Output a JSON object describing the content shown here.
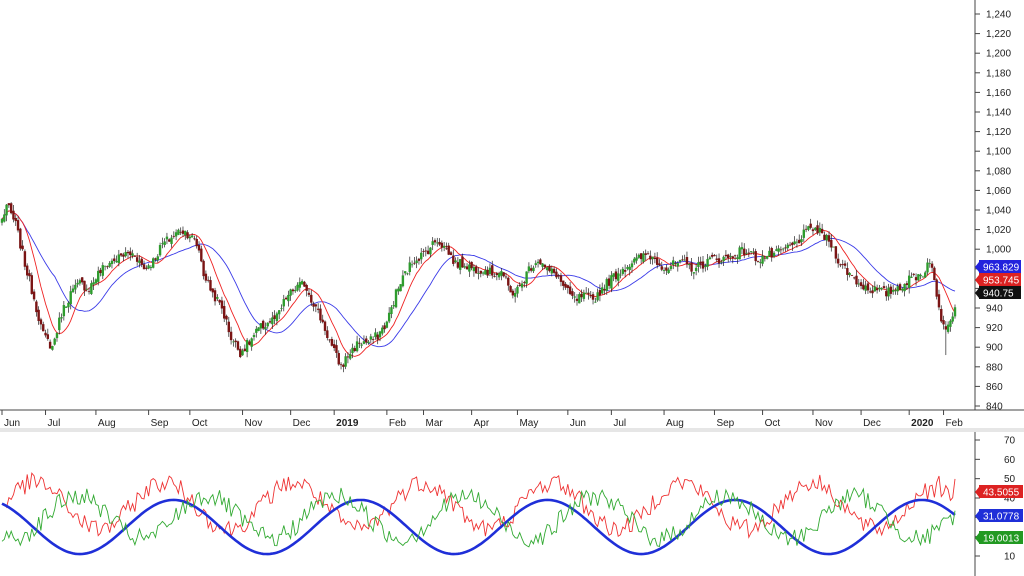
{
  "chart_data": [
    {
      "type": "candlestick",
      "panel": "price",
      "ylim": [
        820,
        1250
      ],
      "y_ticks": [
        "840",
        "860",
        "880",
        "900",
        "920",
        "940",
        "960",
        "980",
        "1,000",
        "1,020",
        "1,040",
        "1,060",
        "1,080",
        "1,100",
        "1,120",
        "1,140",
        "1,160",
        "1,180",
        "1,200",
        "1,220",
        "1,240"
      ],
      "x_labels": [
        {
          "label": "Jun",
          "i": 0
        },
        {
          "label": "Jul",
          "i": 19
        },
        {
          "label": "Aug",
          "i": 41
        },
        {
          "label": "Sep",
          "i": 64
        },
        {
          "label": "Oct",
          "i": 82
        },
        {
          "label": "Nov",
          "i": 105
        },
        {
          "label": "Dec",
          "i": 126
        },
        {
          "label": "2019",
          "i": 145,
          "bold": true
        },
        {
          "label": "Feb",
          "i": 168
        },
        {
          "label": "Mar",
          "i": 184
        },
        {
          "label": "Apr",
          "i": 205
        },
        {
          "label": "May",
          "i": 225
        },
        {
          "label": "Jun",
          "i": 247
        },
        {
          "label": "Jul",
          "i": 266
        },
        {
          "label": "Aug",
          "i": 289
        },
        {
          "label": "Sep",
          "i": 311
        },
        {
          "label": "Oct",
          "i": 332
        },
        {
          "label": "Nov",
          "i": 354
        },
        {
          "label": "Dec",
          "i": 375
        },
        {
          "label": "2020",
          "i": 396,
          "bold": true
        },
        {
          "label": "Feb",
          "i": 411
        }
      ],
      "close_anchors": [
        [
          0,
          1030
        ],
        [
          2,
          1045
        ],
        [
          6,
          1025
        ],
        [
          10,
          985
        ],
        [
          14,
          950
        ],
        [
          18,
          912
        ],
        [
          22,
          900
        ],
        [
          26,
          935
        ],
        [
          30,
          955
        ],
        [
          34,
          965
        ],
        [
          38,
          960
        ],
        [
          42,
          975
        ],
        [
          46,
          985
        ],
        [
          50,
          990
        ],
        [
          54,
          995
        ],
        [
          58,
          995
        ],
        [
          62,
          980
        ],
        [
          66,
          988
        ],
        [
          70,
          1005
        ],
        [
          74,
          1012
        ],
        [
          78,
          1020
        ],
        [
          82,
          1015
        ],
        [
          86,
          1000
        ],
        [
          88,
          975
        ],
        [
          92,
          955
        ],
        [
          96,
          940
        ],
        [
          100,
          910
        ],
        [
          104,
          895
        ],
        [
          108,
          905
        ],
        [
          112,
          918
        ],
        [
          116,
          925
        ],
        [
          120,
          930
        ],
        [
          124,
          950
        ],
        [
          128,
          960
        ],
        [
          132,
          965
        ],
        [
          136,
          945
        ],
        [
          140,
          925
        ],
        [
          144,
          900
        ],
        [
          148,
          880
        ],
        [
          152,
          895
        ],
        [
          156,
          905
        ],
        [
          160,
          905
        ],
        [
          164,
          912
        ],
        [
          168,
          925
        ],
        [
          172,
          955
        ],
        [
          176,
          975
        ],
        [
          180,
          990
        ],
        [
          184,
          995
        ],
        [
          188,
          1005
        ],
        [
          190,
          1010
        ],
        [
          194,
          1000
        ],
        [
          198,
          985
        ],
        [
          202,
          985
        ],
        [
          206,
          980
        ],
        [
          210,
          980
        ],
        [
          214,
          975
        ],
        [
          218,
          978
        ],
        [
          222,
          955
        ],
        [
          226,
          960
        ],
        [
          230,
          980
        ],
        [
          234,
          990
        ],
        [
          238,
          978
        ],
        [
          242,
          975
        ],
        [
          246,
          958
        ],
        [
          250,
          948
        ],
        [
          254,
          952
        ],
        [
          258,
          948
        ],
        [
          262,
          960
        ],
        [
          266,
          970
        ],
        [
          270,
          978
        ],
        [
          274,
          985
        ],
        [
          278,
          990
        ],
        [
          282,
          995
        ],
        [
          286,
          988
        ],
        [
          290,
          980
        ],
        [
          294,
          985
        ],
        [
          298,
          985
        ],
        [
          302,
          980
        ],
        [
          306,
          985
        ],
        [
          310,
          990
        ],
        [
          314,
          990
        ],
        [
          318,
          992
        ],
        [
          322,
          998
        ],
        [
          326,
          997
        ],
        [
          330,
          990
        ],
        [
          334,
          993
        ],
        [
          338,
          995
        ],
        [
          342,
          1000
        ],
        [
          346,
          1005
        ],
        [
          350,
          1015
        ],
        [
          354,
          1022
        ],
        [
          358,
          1015
        ],
        [
          362,
          1005
        ],
        [
          366,
          985
        ],
        [
          370,
          975
        ],
        [
          374,
          965
        ],
        [
          378,
          960
        ],
        [
          382,
          958
        ],
        [
          386,
          955
        ],
        [
          390,
          960
        ],
        [
          394,
          965
        ],
        [
          398,
          972
        ],
        [
          402,
          975
        ],
        [
          404,
          985
        ],
        [
          405,
          990
        ],
        [
          406,
          980
        ],
        [
          408,
          950
        ],
        [
          410,
          930
        ],
        [
          412,
          922
        ],
        [
          414,
          932
        ],
        [
          416,
          940
        ]
      ],
      "last_index": 416,
      "indicators": [
        {
          "name": "ma_slow",
          "color": "#3a3ae8",
          "value_label": "963.829",
          "tag_bg": "#2222dd"
        },
        {
          "name": "ma_fast",
          "color": "#ee2222",
          "value_label": "953.745",
          "tag_bg": "#dd2222"
        },
        {
          "name": "close",
          "color": "#000000",
          "value_label": "940.75",
          "tag_bg": "#111111"
        }
      ]
    },
    {
      "type": "line",
      "panel": "oscillator",
      "ylim": [
        0,
        75
      ],
      "y_ticks": [
        "10",
        "20",
        "30",
        "40",
        "50",
        "60",
        "70"
      ],
      "series": [
        {
          "name": "red",
          "color": "#ee3333",
          "value_label": "43.5055",
          "tag_bg": "#dd2222",
          "mean": 36,
          "amplitude": 12
        },
        {
          "name": "blue",
          "color": "#1f2fd8",
          "value_label": "31.0778",
          "tag_bg": "#1f2fd8",
          "mean": 25,
          "amplitude": 14
        },
        {
          "name": "green",
          "color": "#33aa33",
          "value_label": "19.0013",
          "tag_bg": "#229922",
          "mean": 30,
          "amplitude": 11
        }
      ]
    }
  ]
}
